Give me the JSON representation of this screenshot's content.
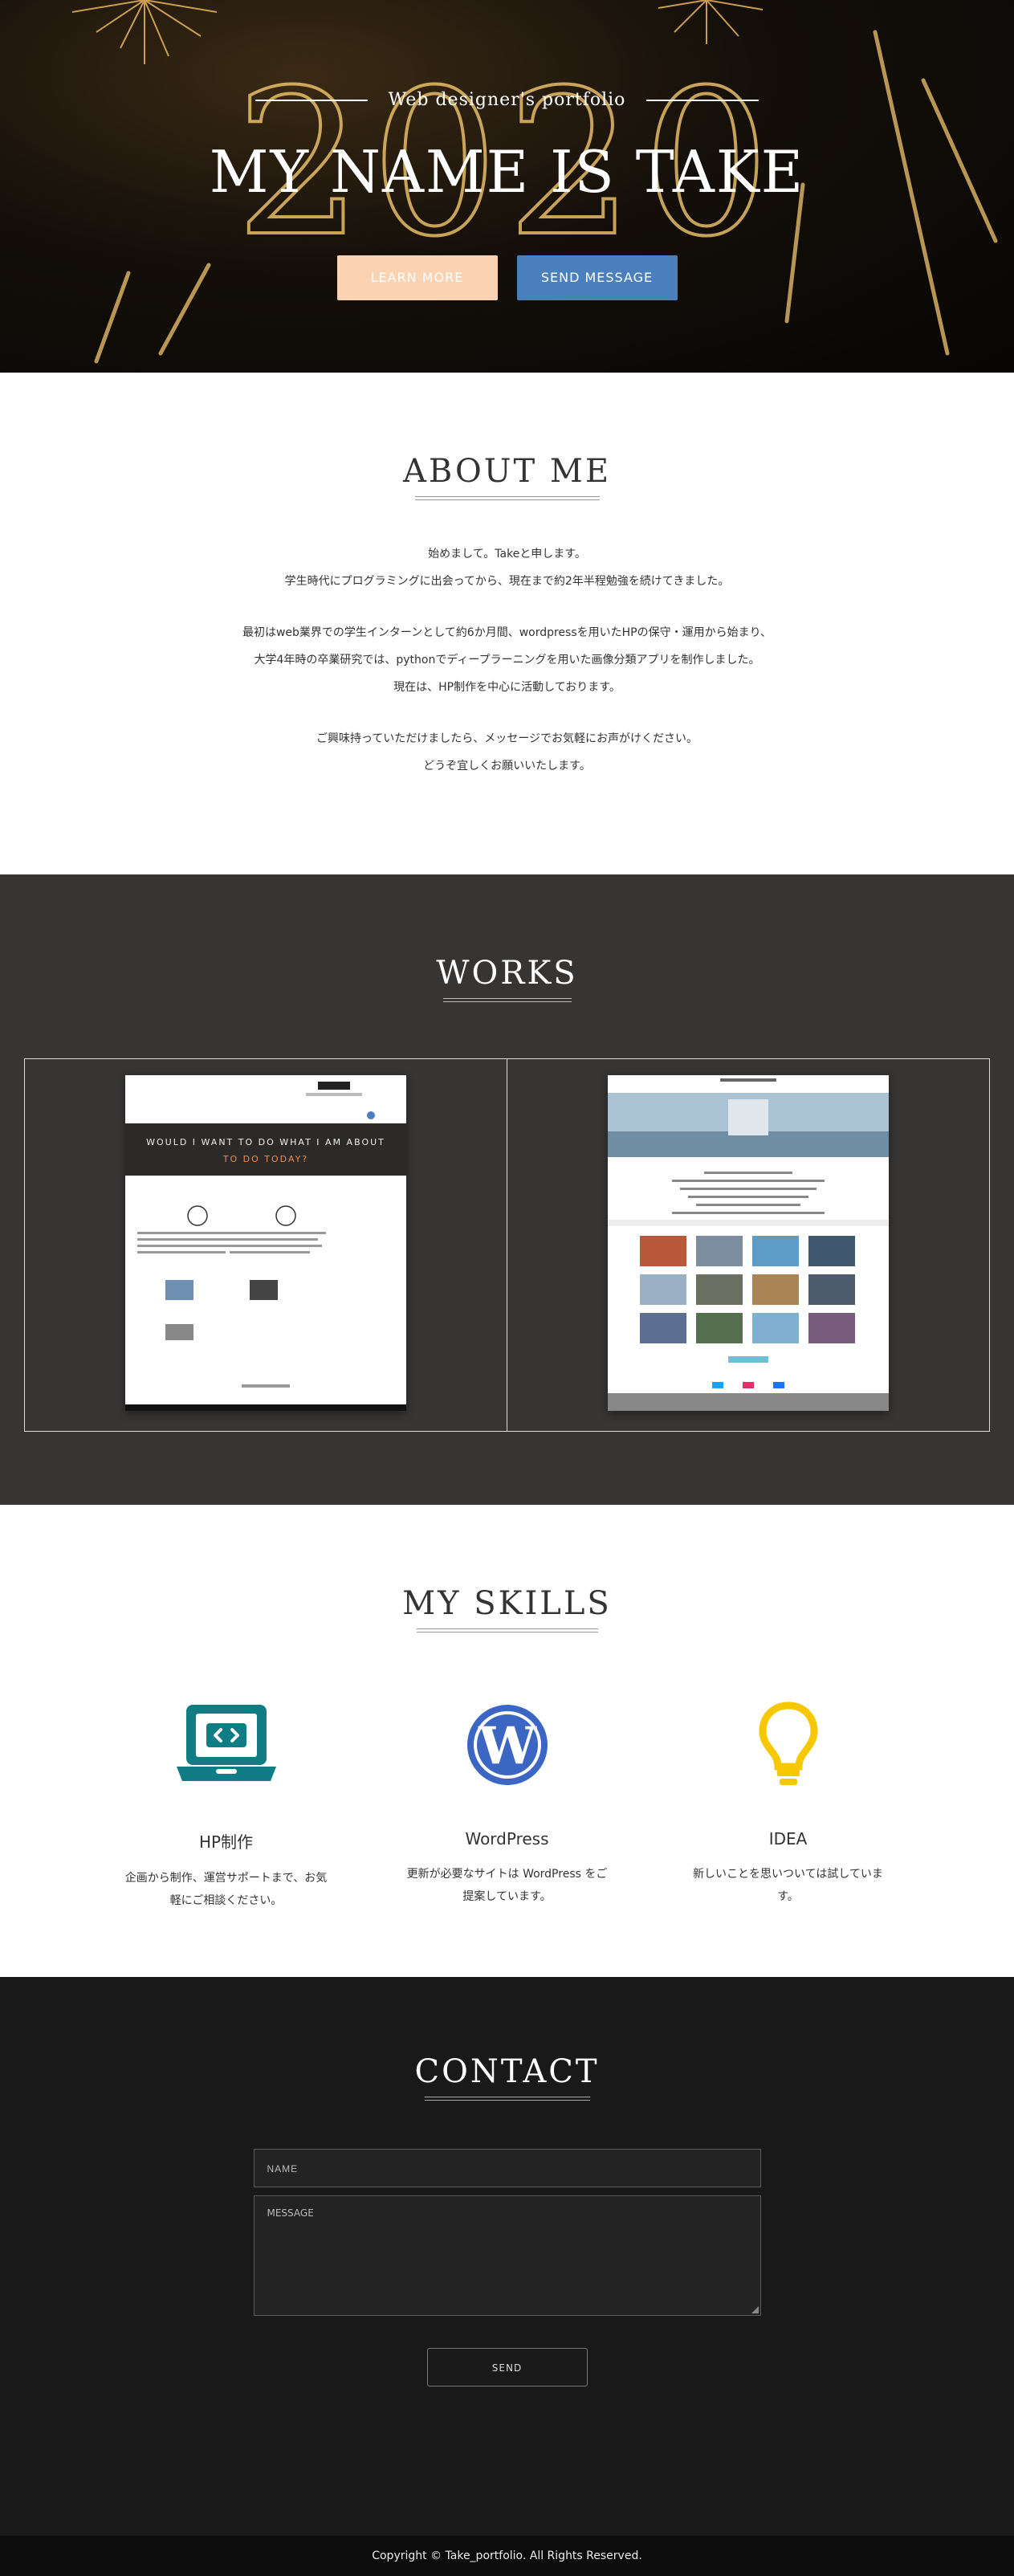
{
  "hero": {
    "subtitle": "Web designer's portfolio",
    "title": "MY NAME IS TAKE",
    "background_text": "2020",
    "learn_more": "LEARN MORE",
    "send_message": "SEND MESSAGE"
  },
  "about": {
    "title": "ABOUT ME",
    "paragraphs": [
      [
        "始めまして。Takeと申します。",
        "学生時代にプログラミングに出会ってから、現在まで約2年半程勉強を続けてきました。"
      ],
      [
        "最初はweb業界での学生インターンとして約6か月間、wordpressを用いたHPの保守・運用から始まり、",
        "大学4年時の卒業研究では、pythonでディープラーニングを用いた画像分類アプリを制作しました。",
        "現在は、HP制作を中心に活動しております。"
      ],
      [
        "ご興味持っていただけましたら、メッセージでお気軽にお声がけください。",
        "どうぞ宜しくお願いいたします。"
      ]
    ]
  },
  "works": {
    "title": "WORKS",
    "items": [
      {
        "name": "work-1",
        "banner_text_1": "WOULD I WANT TO DO WHAT I AM ABOUT",
        "banner_text_2": "TO DO TODAY?"
      },
      {
        "name": "work-2"
      }
    ]
  },
  "skills": {
    "title": "MY SKILLS",
    "items": [
      {
        "icon": "laptop-code-icon",
        "name": "HP制作",
        "desc": "企画から制作、運営サポートまで、お気軽にご相談ください。",
        "color": "#0f7d83"
      },
      {
        "icon": "wordpress-icon",
        "name": "WordPress",
        "desc": "更新が必要なサイトは WordPress をご提案しています。",
        "color": "#3b66c4"
      },
      {
        "icon": "lightbulb-icon",
        "name": "IDEA",
        "desc": "新しいことを思いついては試しています。",
        "color": "#f5c800"
      }
    ]
  },
  "contact": {
    "title": "CONTACT",
    "name_placeholder": "NAME",
    "message_placeholder": "MESSAGE",
    "send": "SEND"
  },
  "footer": {
    "copyright": "Copyright © Take_portfolio. All Rights Reserved."
  },
  "colors": {
    "learn_more_bg": "#fbd2b2",
    "send_message_bg": "#4a80bd",
    "works_bg": "#373533",
    "contact_bg": "#1a1919"
  }
}
